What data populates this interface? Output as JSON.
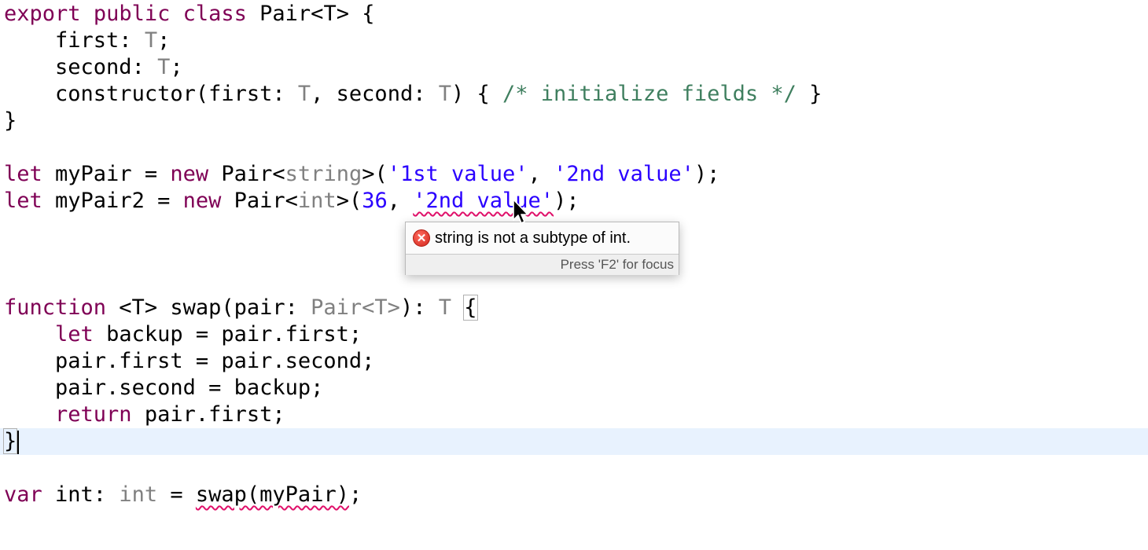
{
  "code": {
    "class_decl": {
      "export": "export",
      "public": "public",
      "class": "class",
      "name_open": " Pair<T> {"
    },
    "field_first": {
      "indent": "    ",
      "name": "first: ",
      "type": "T",
      "end": ";"
    },
    "field_second": {
      "indent": "    ",
      "name": "second: ",
      "type": "T",
      "end": ";"
    },
    "ctor": {
      "indent": "    ",
      "head": "constructor(first: ",
      "t1": "T",
      "mid": ", second: ",
      "t2": "T",
      "tail": ") { ",
      "comment": "/* initialize fields */",
      "close": " }"
    },
    "class_close": "}",
    "let1": {
      "kw": "let",
      "mid": " myPair = ",
      "new": "new",
      "pair": " Pair<",
      "type": "string",
      "open": ">(",
      "arg1": "'1st value'",
      "comma": ", ",
      "arg2": "'2nd value'",
      "end": ");"
    },
    "let2": {
      "kw": "let",
      "mid": " myPair2 = ",
      "new": "new",
      "pair": " Pair<",
      "type": "int",
      "open": ">(",
      "arg1": "36",
      "comma": ", ",
      "arg2": "'2nd value'",
      "end": ");"
    },
    "func": {
      "kw": "function",
      "sig": " <T> swap(pair: ",
      "ptype": "Pair<T>",
      "ret": "): ",
      "rtype": "T",
      "space": " ",
      "brace": "{"
    },
    "body1": {
      "indent": "    ",
      "kw": "let",
      "rest": " backup = pair.first;"
    },
    "body2": {
      "indent": "    ",
      "text": "pair.first = pair.second;"
    },
    "body3": {
      "indent": "    ",
      "text": "pair.second = backup;"
    },
    "body4": {
      "indent": "    ",
      "kw": "return",
      "rest": " pair.first;"
    },
    "func_close": "}",
    "var_line": {
      "kw": "var",
      "mid": " int: ",
      "type": "int",
      "eq": " = ",
      "call": "swap(myPair)",
      "end": ";"
    }
  },
  "tooltip": {
    "message": "string is not a subtype of int.",
    "status": "Press 'F2' for focus",
    "icon": "error-icon"
  },
  "colors": {
    "keyword": "#7f0055",
    "type_param": "#808080",
    "string": "#2a00ff",
    "comment": "#3f7f5f",
    "current_line": "#e8f2fe",
    "error_underline": "#e0106a"
  }
}
